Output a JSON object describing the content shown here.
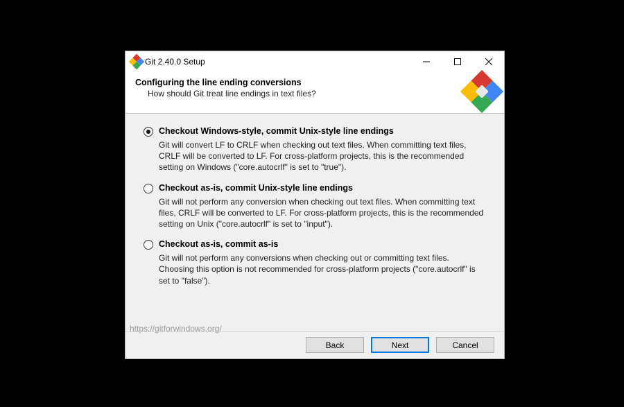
{
  "window": {
    "title": "Git 2.40.0 Setup"
  },
  "header": {
    "heading": "Configuring the line ending conversions",
    "subheading": "How should Git treat line endings in text files?"
  },
  "options": [
    {
      "label": "Checkout Windows-style, commit Unix-style line endings",
      "desc": "Git will convert LF to CRLF when checking out text files. When committing text files, CRLF will be converted to LF. For cross-platform projects, this is the recommended setting on Windows (\"core.autocrlf\" is set to \"true\").",
      "selected": true
    },
    {
      "label": "Checkout as-is, commit Unix-style line endings",
      "desc": "Git will not perform any conversion when checking out text files. When committing text files, CRLF will be converted to LF. For cross-platform projects, this is the recommended setting on Unix (\"core.autocrlf\" is set to \"input\").",
      "selected": false
    },
    {
      "label": "Checkout as-is, commit as-is",
      "desc": "Git will not perform any conversions when checking out or committing text files. Choosing this option is not recommended for cross-platform projects (\"core.autocrlf\" is set to \"false\").",
      "selected": false
    }
  ],
  "footer": {
    "link": "https://gitforwindows.org/",
    "back": "Back",
    "next": "Next",
    "cancel": "Cancel"
  }
}
